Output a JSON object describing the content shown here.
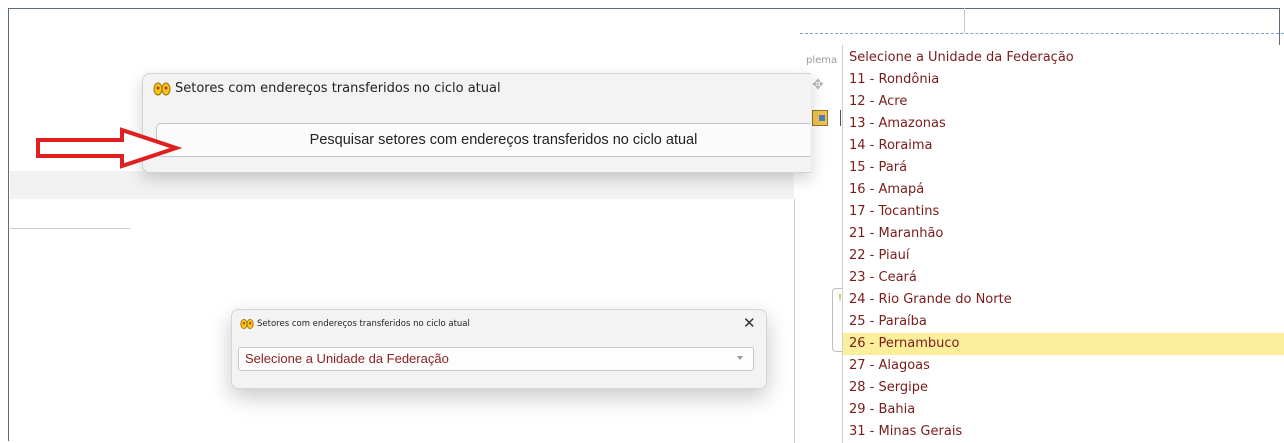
{
  "top_dialog": {
    "title": "Setores com endereços transferidos no ciclo atual",
    "button_label": "Pesquisar setores com endereços transferidos no ciclo atual"
  },
  "bottom_dialog": {
    "title": "Setores com endereços transferidos no ciclo atual",
    "close": "✕",
    "select_value": "Selecione a Unidade da Federação"
  },
  "background": {
    "partial_label": "plema"
  },
  "dropdown": {
    "items": [
      "Selecione a Unidade da Federação",
      "11 - Rondônia",
      "12 - Acre",
      "13 - Amazonas",
      "14 - Roraima",
      "15 - Pará",
      "16 - Amapá",
      "17 - Tocantins",
      "21 - Maranhão",
      "22 - Piauí",
      "23 - Ceará",
      "24 - Rio Grande do Norte",
      "25 - Paraíba",
      "26 - Pernambuco",
      "27 - Alagoas",
      "28 - Sergipe",
      "29 - Bahia",
      "31 - Minas Gerais"
    ],
    "highlighted": "26 - Pernambuco"
  },
  "colors": {
    "list_text": "#7a1c1c",
    "highlight": "#fbef9c",
    "arrow": "#e02020"
  },
  "icons": {
    "title_icon": "yellow-footprints-icon",
    "annotation": "red-arrow-icon"
  }
}
